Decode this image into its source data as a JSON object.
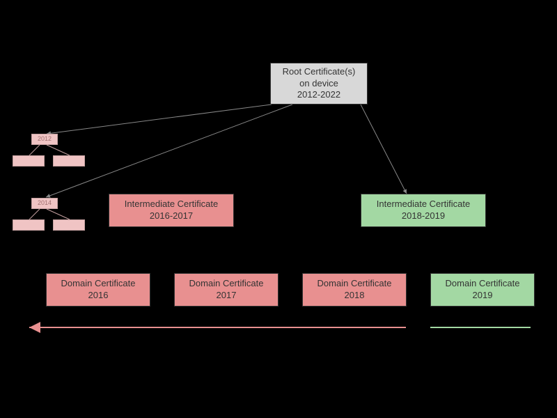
{
  "root": {
    "line1": "Root Certificate(s)",
    "line2": "on device",
    "line3": "2012-2022"
  },
  "faded_top": "2012",
  "faded_mid": "2014",
  "intermediate_left": {
    "line1": "Intermediate Certificate",
    "line2": "2016-2017"
  },
  "intermediate_right": {
    "line1": "Intermediate Certificate",
    "line2": "2018-2019"
  },
  "domain": [
    {
      "line1": "Domain Certificate",
      "line2": "2016"
    },
    {
      "line1": "Domain Certificate",
      "line2": "2017"
    },
    {
      "line1": "Domain Certificate",
      "line2": "2018"
    },
    {
      "line1": "Domain Certificate",
      "line2": "2019"
    }
  ],
  "colors": {
    "pink_arrow": "#e89090",
    "green_arrow": "#a3d8a3",
    "gray_arrow": "#888"
  }
}
